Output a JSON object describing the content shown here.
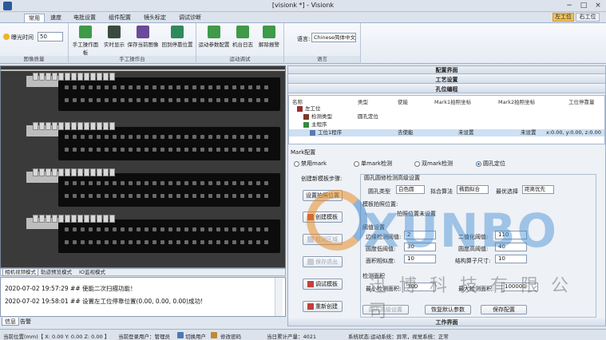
{
  "window": {
    "title": "[visionk *] - Visionk",
    "station_left": "左工位",
    "station_right": "右工位",
    "controls": [
      "−",
      "□",
      "×"
    ]
  },
  "ribbon": {
    "tabs": [
      "常用",
      "速度",
      "电批设置",
      "组件配置",
      "镜头标定",
      "调试诊断"
    ],
    "groups": {
      "image_quality": {
        "label": "图像质量",
        "exposure_label": "曝光时间",
        "exposure_value": "50"
      },
      "manual": {
        "label": "手工操作台",
        "buttons": [
          "手工操作面板",
          "实时显示",
          "保存当前图像",
          "回到停靠位置"
        ]
      },
      "motion": {
        "label": "运动调试",
        "buttons": [
          "运动参数配置",
          "机台日志",
          "解除报警"
        ]
      },
      "language": {
        "label": "语言",
        "select_label": "语言:",
        "value": "Chinese简体中文"
      }
    }
  },
  "camera": {
    "tabs": [
      "相机视频模式",
      "轨迹预览模式",
      "IO监视模式"
    ]
  },
  "log": {
    "lines": [
      "2020-07-02 19:57:29 ## 使能二次扫描功能！",
      "2020-07-02 19:58:01 ## 设置左工位停靠位置(0.00, 0.00, 0.00)成功!"
    ],
    "tabs": [
      "信息",
      "告警"
    ]
  },
  "right": {
    "sections": [
      "配置界面",
      "工艺设置",
      "孔位编程"
    ],
    "tree": {
      "headers": [
        "名称",
        "类型",
        "使能",
        "Mark1拍照坐标",
        "Mark2拍照坐标",
        "工位停靠量"
      ],
      "rows": [
        {
          "name": "左工位",
          "type": "",
          "enable": "",
          "m1": "",
          "m2": "",
          "dock": ""
        },
        {
          "name": "检测类型",
          "type": "圆孔定位",
          "enable": "",
          "m1": "",
          "m2": "",
          "dock": ""
        },
        {
          "name": "主程序",
          "type": "",
          "enable": "",
          "m1": "",
          "m2": "",
          "dock": ""
        },
        {
          "name": "工位1程序",
          "type": "",
          "enable": "去使能",
          "m1": "未设置",
          "m2": "未设置",
          "dock": "x:0.00, y:0.00, z:0.00"
        }
      ]
    },
    "mark": {
      "title": "Mark配置",
      "options": [
        "禁用mark",
        "单mark检测",
        "双mark检测",
        "圆孔定位"
      ],
      "selected": "圆孔定位"
    },
    "steps": {
      "title": "创建新模板步骤:",
      "buttons": [
        "设置拍照位置",
        "创建模板",
        "检测区域",
        "保存退出",
        "调试模板",
        "重新创建"
      ]
    },
    "hole": {
      "title": "圆孔圆修检测高级设置",
      "hole_type_label": "圆孔类型",
      "hole_type_value": "白色圆",
      "fit_label": "拟合算法",
      "fit_value": "椭圆拟合",
      "priority_label": "最优选择",
      "priority_value": "距离优先",
      "template_pos_label": "模板拍照位置:",
      "template_pos_value": "拍照位置未设置",
      "threshold_title": "阈值设置",
      "edge_threshold_label": "边缘检测阈值:",
      "edge_threshold_value": "2",
      "binary_threshold_label": "二值化阈值:",
      "binary_threshold_value": "110",
      "circle_low_label": "圆度低阈值:",
      "circle_low_value": "30",
      "circle_high_label": "圆度高阈值:",
      "circle_high_value": "40",
      "area_similarity_label": "面积相似度:",
      "area_similarity_value": "10",
      "struct_size_label": "结构算子尺寸:",
      "struct_size_value": "10",
      "area_title": "检测面积",
      "min_area_label": "最小检测面积:",
      "min_area_value": "300",
      "max_area_label": "最大检测面积:",
      "max_area_value": "100000",
      "adv_button": "圆孔高级设置",
      "reset_button": "恢复默认参数",
      "save_button": "保存配置"
    },
    "work_section": "工作界面"
  },
  "watermark": {
    "brand": "XUNBO",
    "sub": "迅博科技有限公司"
  },
  "status": {
    "position": "当前位置(mm)【 X: 0.00  Y: 0.00  Z: 0.00 】",
    "user": "当前登录用户：管理员",
    "switch_user": "切换用户",
    "change_password": "修改密码",
    "count": "当日累计产量：4021",
    "system_status": "系统状态:运动系统：异常，视觉系统：正常"
  }
}
